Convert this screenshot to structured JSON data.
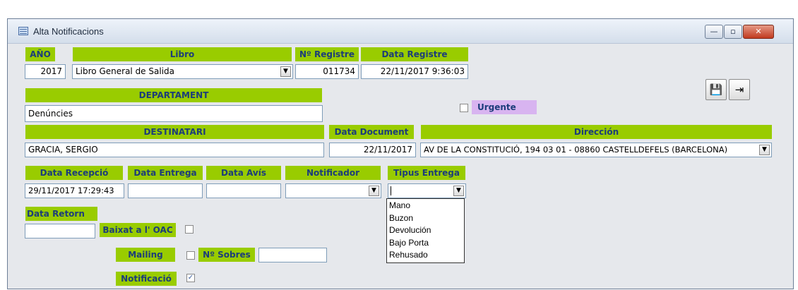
{
  "window": {
    "title": "Alta Notificacions",
    "minimize": "—",
    "maximize": "▫",
    "close": "✕"
  },
  "toolbar": {
    "save_icon": "save-disk-icon",
    "exit_icon": "exit-door-icon",
    "save_glyph": "💾",
    "exit_glyph": "⇥"
  },
  "labels": {
    "any": "AÑO",
    "libro": "Libro",
    "num_registre": "Nº Registre",
    "data_registre": "Data Registre",
    "departament": "DEPARTAMENT",
    "urgente": "Urgente",
    "destinatari": "DESTINATARI",
    "data_document": "Data Document",
    "direccion": "Dirección",
    "data_recepcio": "Data Recepció",
    "data_entrega": "Data Entrega",
    "data_avis": "Data Avís",
    "notificador": "Notificador",
    "tipus_entrega": "Tipus Entrega",
    "data_retorn": "Data Retorn",
    "baixat_oac": "Baixat a l' OAC",
    "mailing": "Mailing",
    "num_sobres": "Nº Sobres",
    "notificacio": "Notificació"
  },
  "values": {
    "any": "2017",
    "libro": "Libro General de Salida",
    "num_registre": "011734",
    "data_registre": "22/11/2017 9:36:03",
    "departament": "Denúncies",
    "destinatari": "GRACIA, SERGIO",
    "data_document": "22/11/2017",
    "direccion": "AV DE LA CONSTITUCIÓ,  194 03 01 - 08860 CASTELLDEFELS (BARCELONA)",
    "data_recepcio": "29/11/2017 17:29:43",
    "data_entrega": "",
    "data_avis": "",
    "notificador": "",
    "tipus_entrega": "",
    "data_retorn": "",
    "num_sobres": "",
    "urgente_checked": false,
    "baixat_checked": false,
    "mailing_checked": false,
    "notificacio_checked": true
  },
  "tipus_entrega_options": [
    "Mano",
    "Buzon",
    "Devolución",
    "Bajo Porta",
    "Rehusado"
  ],
  "colors": {
    "label_bg": "#99cc00",
    "label_text": "#1c3d7a",
    "urgente_bg": "#d8b4f0",
    "window_bg": "#e6e8ec"
  }
}
